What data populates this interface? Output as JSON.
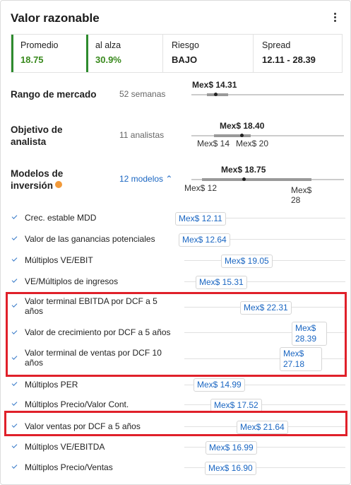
{
  "title": "Valor razonable",
  "stats": [
    {
      "label": "Promedio",
      "value": "18.75"
    },
    {
      "label": "al alza",
      "value": "30.9%"
    },
    {
      "label": "Riesgo",
      "value": "BAJO"
    },
    {
      "label": "Spread",
      "value": "12.11 - 28.39"
    }
  ],
  "market_range": {
    "label": "Rango de mercado",
    "sub": "52 semanas",
    "value": "Mex$ 14.31"
  },
  "analyst_target": {
    "label1": "Objetivo de",
    "label2": "analista",
    "sub": "11 analistas",
    "value": "Mex$ 18.40",
    "low": "Mex$ 14",
    "high": "Mex$ 20"
  },
  "investment_models": {
    "label1": "Modelos de",
    "label2": "inversión",
    "toggle": "12 modelos ⌃",
    "value": "Mex$ 18.75",
    "low": "Mex$ 12",
    "high1": "Mex$",
    "high2": "28"
  },
  "models": [
    {
      "label": "Crec. estable MDD",
      "value": "Mex$ 12.11"
    },
    {
      "label": "Valor de las ganancias potenciales",
      "value": "Mex$ 12.64"
    },
    {
      "label": "Múltiplos VE/EBIT",
      "value": "Mex$ 19.05"
    },
    {
      "label": "VE/Múltiplos de ingresos",
      "value": "Mex$ 15.31"
    },
    {
      "label1": "Valor terminal EBITDA por DCF a 5",
      "label2": "años",
      "value": "Mex$ 22.31"
    },
    {
      "label": "Valor de crecimiento por DCF a 5 años",
      "value1": "Mex$",
      "value2": "28.39"
    },
    {
      "label1": "Valor terminal de ventas por DCF 10",
      "label2": "años",
      "value1": "Mex$",
      "value2": "27.18"
    },
    {
      "label": "Múltiplos PER",
      "value": "Mex$ 14.99"
    },
    {
      "label": "Múltiplos Precio/Valor Cont.",
      "value": "Mex$ 17.52"
    },
    {
      "label": "Valor ventas por DCF a 5 años",
      "value": "Mex$ 21.64"
    },
    {
      "label": "Múltiplos VE/EBITDA",
      "value": "Mex$ 16.99"
    },
    {
      "label": "Múltiplos Precio/Ventas",
      "value": "Mex$ 16.90"
    }
  ]
}
